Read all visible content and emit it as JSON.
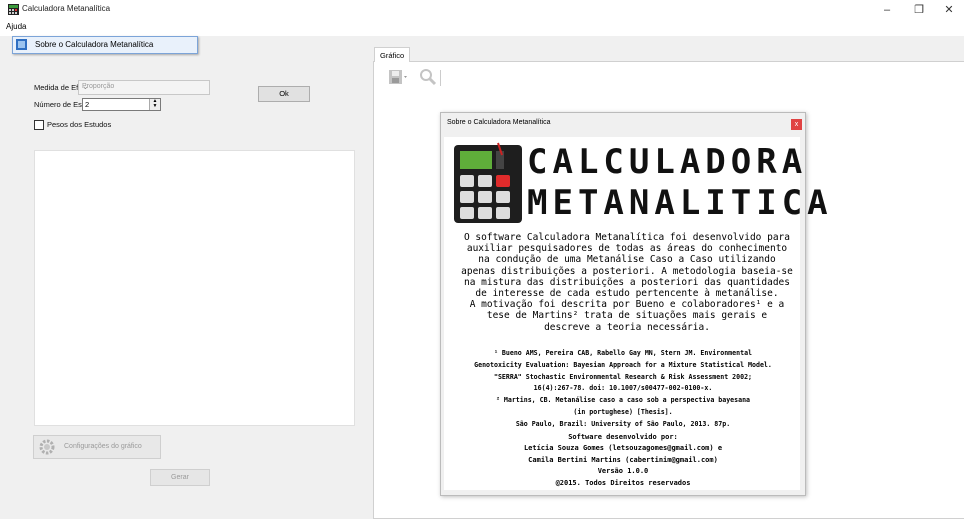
{
  "window": {
    "title": "Calculadora Metanalítica",
    "minimize": "–",
    "maximize": "❐",
    "close": "✕"
  },
  "menu": {
    "ajuda": "Ajuda",
    "sobre_item": "Sobre o Calculadora Metanalítica"
  },
  "form": {
    "medida_label": "Medida de Efeito:",
    "medida_value": "Proporção",
    "numero_label": "Número de Estudos:",
    "numero_value": "2",
    "ok_button": "Ok",
    "pesos_label": "Pesos dos Estudos",
    "config_button": "Configurações do gráfico",
    "gerar_button": "Gerar"
  },
  "chart_tab": {
    "label": "Gráfico"
  },
  "about": {
    "title": "Sobre o Calculadora Metanalítica",
    "close": "x",
    "logo_line1": "CALCULADORA",
    "logo_line2": "METANALITICA",
    "description": [
      "O software  Calculadora Metanalítica foi desenvolvido para",
      "auxiliar pesquisadores de todas as áreas do conhecimento",
      "na condução  de uma  Metanálise  Caso a Caso  utilizando",
      "apenas distribuições a posteriori. A metodologia baseia-se",
      "na mistura das distribuições a posteriori  das quantidades",
      "de interesse  de cada estudo  pertencente  à metanálise.",
      "A motivação foi descrita  por Bueno e colaboradores¹ e a",
      "tese  de  Martins²  trata  de  situações  mais  gerais  e",
      "descreve a teoria necessária."
    ],
    "references": [
      "¹ Bueno AMS, Pereira CAB, Rabello Gay MN, Stern JM. Environmental",
      "Genotoxicity Evaluation: Bayesian Approach  for a Mixture Statistical Model.",
      "\"SERRA\" Stochastic Environmental Research & Risk Assessment  2002;",
      "16(4):267-78. doi: 10.1007/s00477-002-0100-x.",
      "² Martins, CB. Metanálise caso a caso sob a perspectiva bayesana",
      "(in portughese) [Thesis].",
      "São Paulo, Brazil: University of São Paulo, 2013. 87p."
    ],
    "credits": [
      "Software desenvolvido por:",
      "Letícia Souza Gomes (letsouzagomes@gmail.com) e",
      "Camila Bertini Martins (cabertinim@gmail.com)",
      "Versão 1.0.0",
      "@2015. Todos Direitos reservados"
    ]
  }
}
